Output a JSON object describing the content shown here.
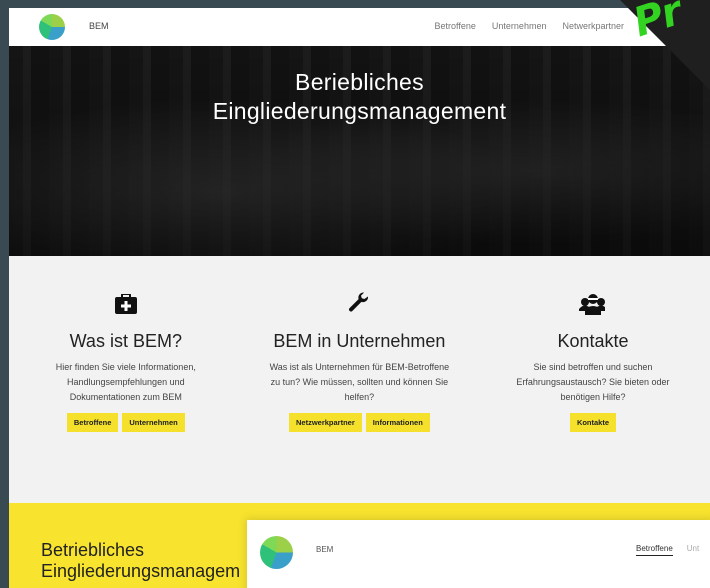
{
  "header": {
    "brand": "BEM",
    "nav": [
      "Betroffene",
      "Unternehmen",
      "Netwerkpartner"
    ]
  },
  "banner": {
    "text": "Pr"
  },
  "hero": {
    "title_line1": "Beriebliches",
    "title_line2": "Eingliederungsmanagement"
  },
  "features": [
    {
      "icon": "first-aid-kit-icon",
      "title": "Was ist BEM?",
      "desc": "Hier finden Sie viele Informationen, Handlungsempfehlungen und Dokumentationen zum BEM",
      "buttons": [
        "Betroffene",
        "Unternehmen"
      ]
    },
    {
      "icon": "wrench-icon",
      "title": "BEM in Unternehmen",
      "desc": "Was ist als Unternehmen für BEM-Betroffene zu tun? Wie müssen, sollten und können Sie helfen?",
      "buttons": [
        "Netzwerkpartner",
        "Informationen"
      ]
    },
    {
      "icon": "people-group-icon",
      "title": "Kontakte",
      "desc": "Sie sind betroffen und suchen Erfahrungsaustausch? Sie bieten oder benötigen Hilfe?",
      "buttons": [
        "Kontakte"
      ]
    }
  ],
  "yellow": {
    "title_line1": "Betriebliches",
    "title_line2": "Eingliederungsmanagem"
  },
  "overlay": {
    "brand": "BEM",
    "nav_active": "Betroffene",
    "nav_muted": "Unt"
  },
  "colors": {
    "accent_yellow": "#f8e42e",
    "button_yellow": "#f5e12c",
    "banner_green": "#33d421"
  }
}
